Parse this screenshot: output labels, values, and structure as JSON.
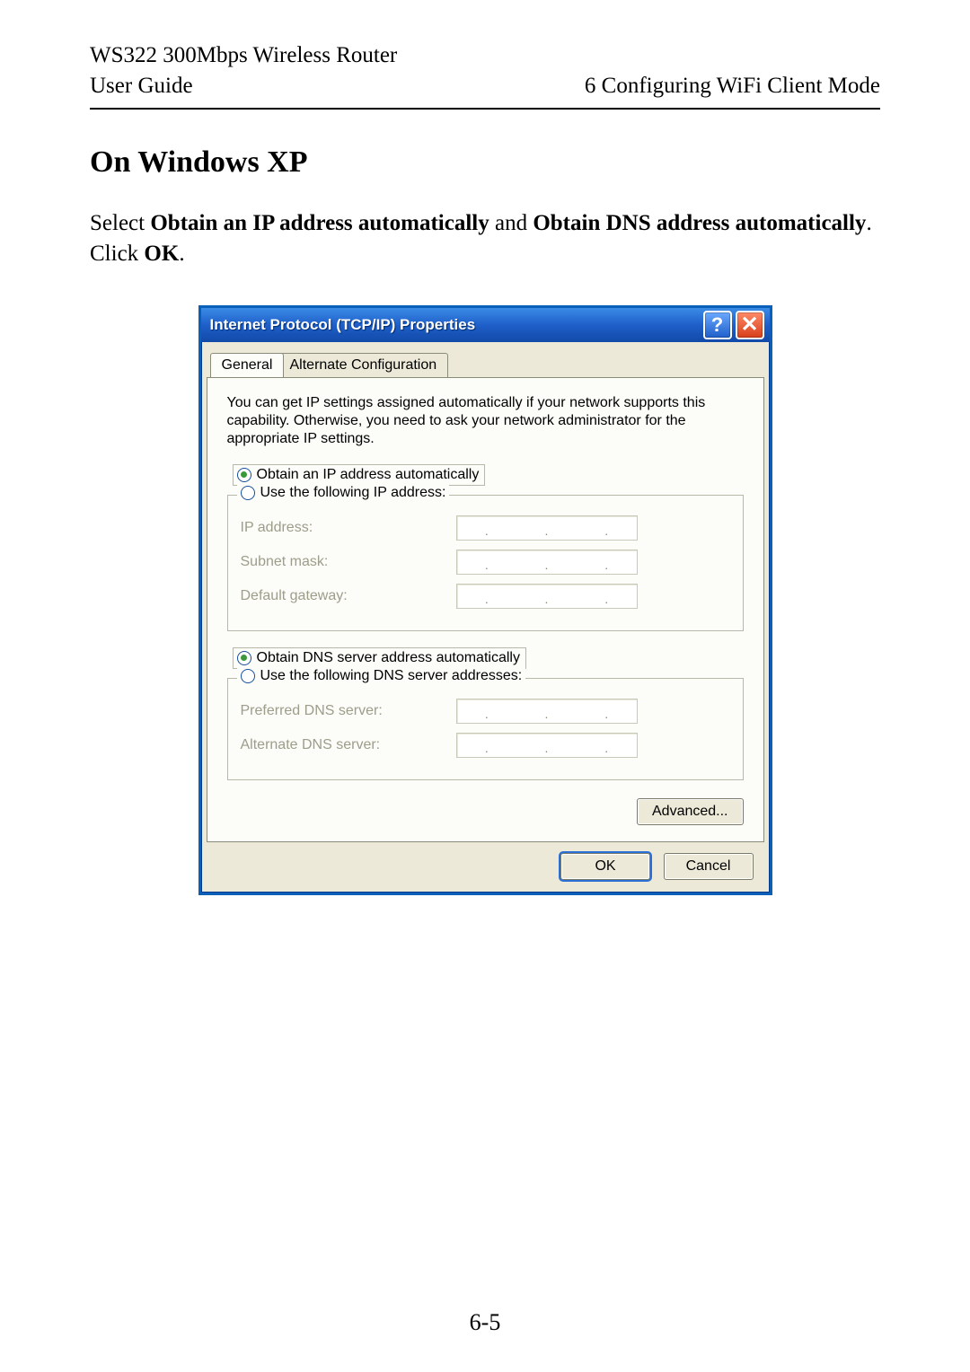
{
  "header": {
    "product": "WS322 300Mbps Wireless Router",
    "doc": "User Guide",
    "chapter": "6 Configuring WiFi Client Mode"
  },
  "section": {
    "heading": "On Windows XP",
    "p_select": "Select ",
    "p_b1": "Obtain an IP address automatically",
    "p_and": " and ",
    "p_b2": "Obtain DNS address automatically",
    "p_click": ". Click ",
    "p_b3": "OK",
    "p_end": "."
  },
  "dialog": {
    "title": "Internet Protocol (TCP/IP) Properties",
    "help": "?",
    "close": "✕",
    "tabs": {
      "general": "General",
      "alt": "Alternate Configuration"
    },
    "info": "You can get IP settings assigned automatically if your network supports this capability. Otherwise, you need to ask your network administrator for the appropriate IP settings.",
    "ip": {
      "auto": "Obtain an IP address automatically",
      "manual": "Use the following IP address:",
      "ip_label": "IP address:",
      "subnet_label": "Subnet mask:",
      "gw_label": "Default gateway:"
    },
    "dns": {
      "auto": "Obtain DNS server address automatically",
      "manual": "Use the following DNS server addresses:",
      "pref_label": "Preferred DNS server:",
      "alt_label": "Alternate DNS server:"
    },
    "advanced": "Advanced...",
    "ok": "OK",
    "cancel": "Cancel"
  },
  "page_number": "6-5"
}
